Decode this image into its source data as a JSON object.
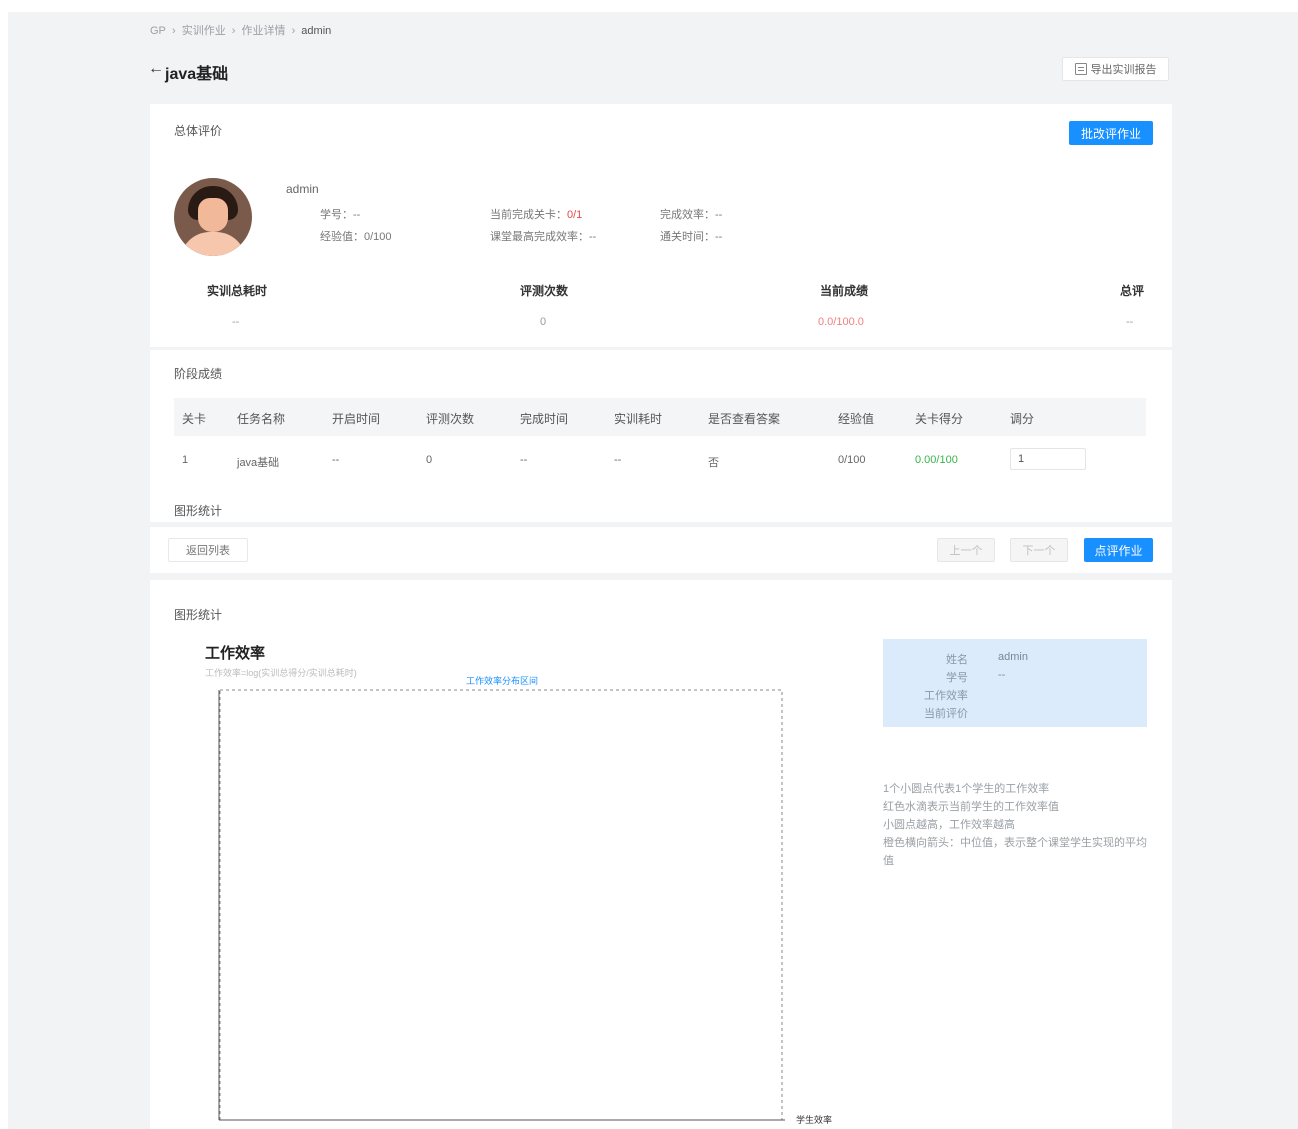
{
  "breadcrumb": [
    "GP",
    "›",
    "实训作业",
    "›",
    "作业详情",
    "›",
    "admin"
  ],
  "page": {
    "back": "←",
    "title": "java基础",
    "export_label": "导出实训报告"
  },
  "overall": {
    "label": "总体评价",
    "adjust_btn": "批改评作业",
    "username": "admin",
    "fields": {
      "student_no": "学号：--",
      "exp": "经验值：0/100",
      "current_level": "当前完成关卡：",
      "current_level_val": "0/1",
      "class_rate": "课堂最高完成效率：--",
      "efficiency": "完成效率：--",
      "pass_time": "通关时间：--"
    },
    "stats": {
      "headers": [
        "实训总耗时",
        "评测次数",
        "当前成绩",
        "总评"
      ],
      "values": [
        "--",
        "0",
        "0.0/100.0",
        "--"
      ]
    }
  },
  "stage": {
    "label": "阶段成绩",
    "columns": [
      "关卡",
      "任务名称",
      "开启时间",
      "评测次数",
      "完成时间",
      "实训耗时",
      "是否查看答案",
      "经验值",
      "关卡得分",
      "调分"
    ],
    "row": [
      "1",
      "java基础",
      "--",
      "0",
      "--",
      "--",
      "否",
      "0/100",
      "0.00/100",
      "1"
    ]
  },
  "stats_label": "图形统计",
  "footer": {
    "back_list": "返回列表",
    "prev": "上一个",
    "next": "下一个",
    "grade": "点评作业"
  },
  "chart": {
    "section_label": "图形统计",
    "title": "工作效率",
    "subtitle": "工作效率=log(实训总得分/实训总耗时)",
    "legend": "工作效率分布区间",
    "xlabel": "学生效率"
  },
  "tooltip": {
    "labels": [
      "姓名",
      "学号",
      "工作效率",
      "当前评价"
    ],
    "values": [
      "admin",
      "--",
      "",
      ""
    ]
  },
  "description": [
    "1个小圆点代表1个学生的工作效率",
    "红色水滴表示当前学生的工作效率值",
    "小圆点越高，工作效率越高",
    "橙色横向箭头：中位值，表示整个课堂学生实现的平均值"
  ],
  "colors": {
    "accent": "#1890ff",
    "red": "#e24a4a",
    "green": "#3bb34a",
    "tip_bg": "#dcebfb"
  }
}
